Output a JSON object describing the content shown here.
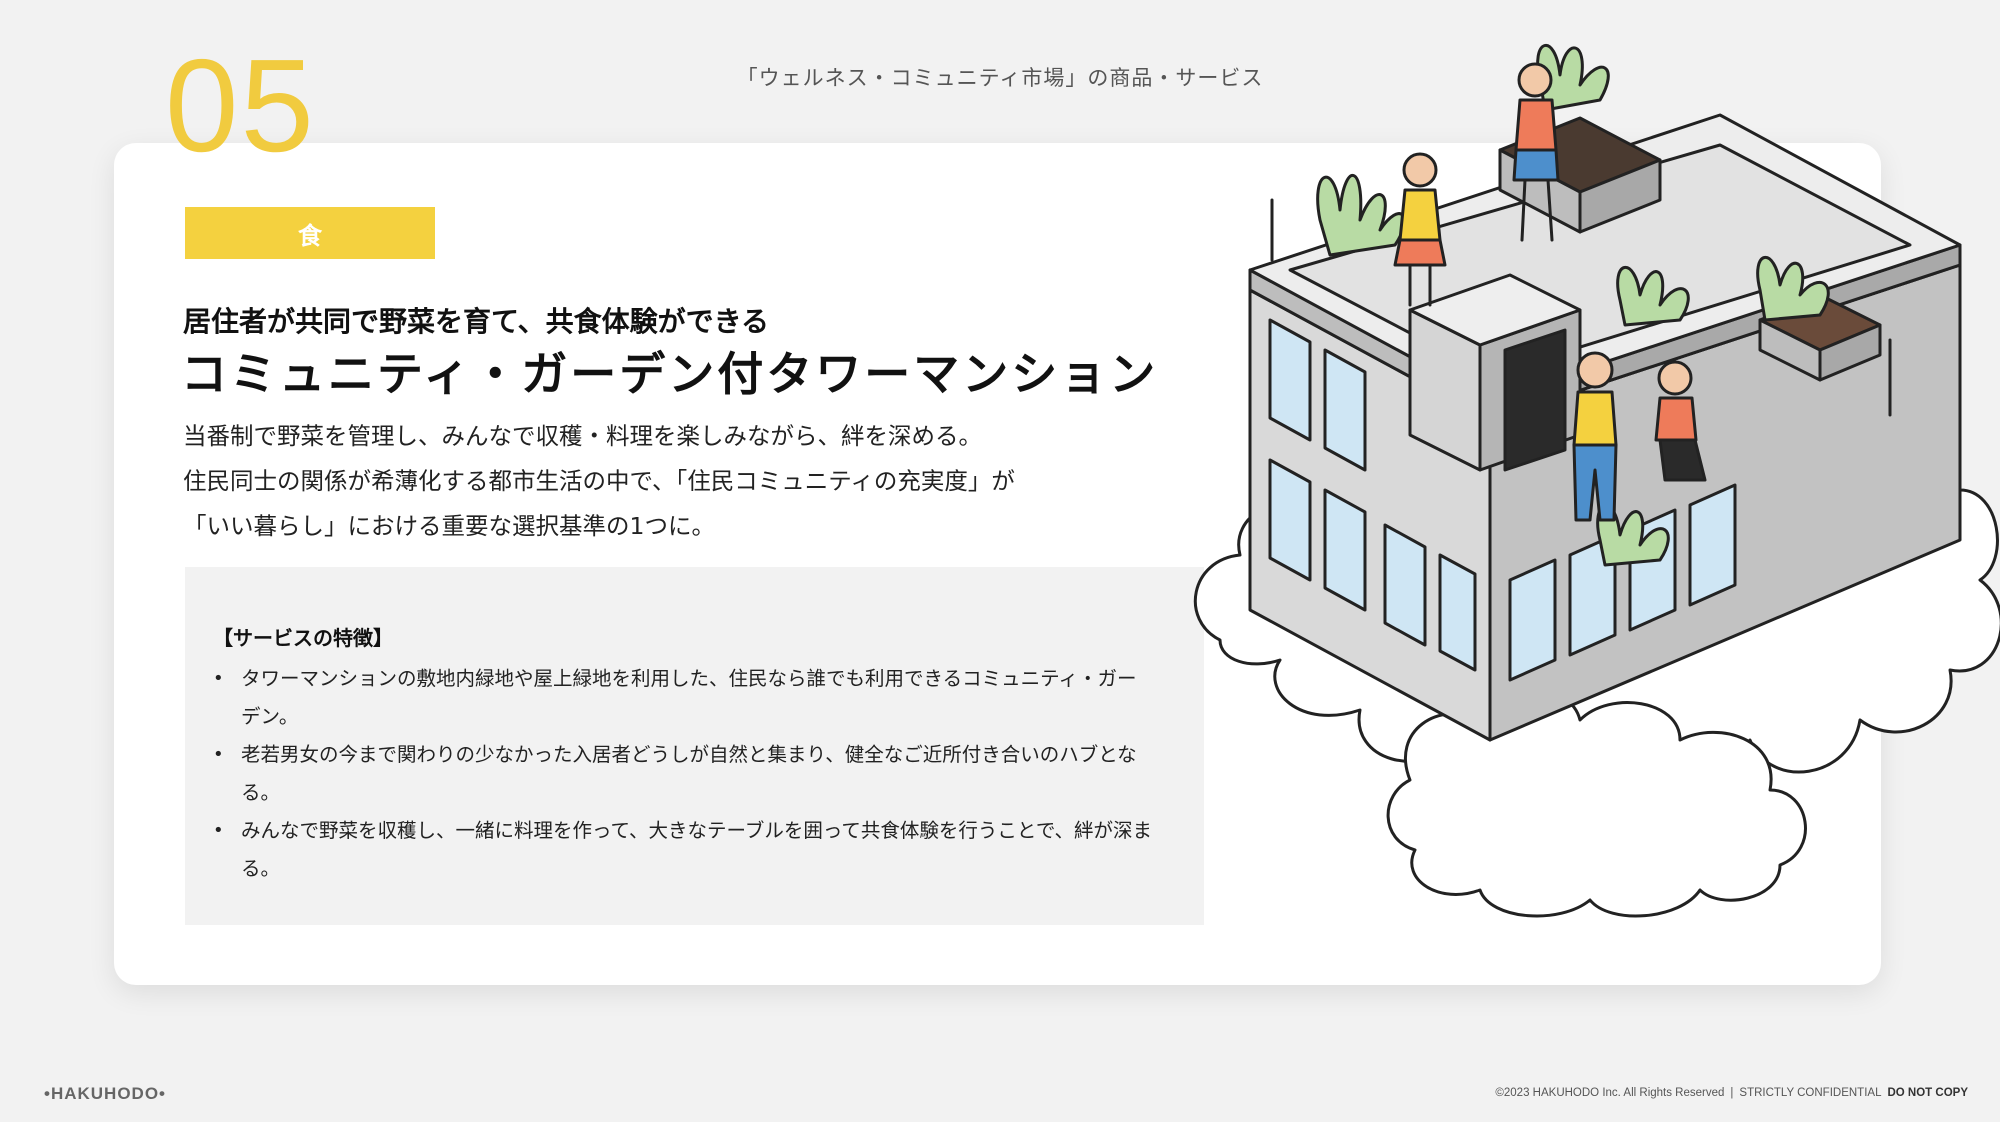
{
  "header": {
    "slide_number": "05",
    "section_title": "「ウェルネス・コミュニティ市場」の商品・サービス"
  },
  "card": {
    "category": "食",
    "subtitle": "居住者が共同で野菜を育て、共食体験ができる",
    "title": "コミュニティ・ガーデン付タワーマンション",
    "description": [
      "当番制で野菜を管理し、みんなで収穫・料理を楽しみながら、絆を深める。",
      "住民同士の関係が希薄化する都市生活の中で、「住民コミュニティの充実度」が",
      "「いい暮らし」における重要な選択基準の1つに。"
    ],
    "features": {
      "heading": "【サービスの特徴】",
      "items": [
        "タワーマンションの敷地内緑地や屋上緑地を利用した、住民なら誰でも利用できるコミュニティ・ガーデン。",
        "老若男女の今まで関わりの少なかった入居者どうしが自然と集まり、健全なご近所付き合いのハブとなる。",
        "みんなで野菜を収穫し、一緒に料理を作って、大きなテーブルを囲って共食体験を行うことで、絆が深まる。"
      ]
    }
  },
  "footer": {
    "logo": "•HAKUHODO•",
    "copyright": "©2023 HAKUHODO Inc. All Rights Reserved",
    "confidential": "STRICTLY CONFIDENTIAL",
    "do_not_copy": "DO NOT COPY"
  },
  "colors": {
    "accent_yellow": "#f4d13f",
    "slide_number_yellow": "#f1cb3f",
    "background": "#f2f2f2",
    "card": "#ffffff"
  }
}
